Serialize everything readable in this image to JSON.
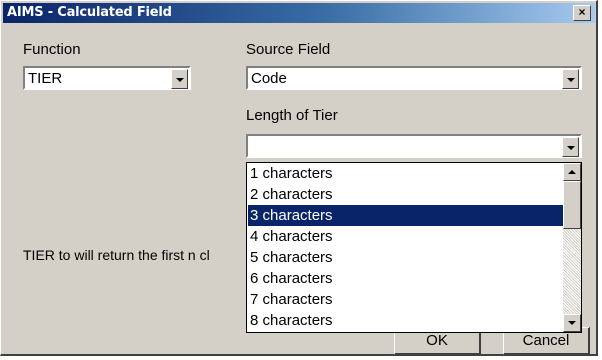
{
  "window": {
    "title": "AIMS - Calculated Field",
    "close_label": "×"
  },
  "function": {
    "label": "Function",
    "value": "TIER"
  },
  "source_field": {
    "label": "Source Field",
    "value": "Code"
  },
  "length_of_tier": {
    "label": "Length of Tier",
    "value": ""
  },
  "description": "TIER to will return the first n cl",
  "dropdown": {
    "options": [
      "1 characters",
      "2 characters",
      "3 characters",
      "4 characters",
      "5 characters",
      "6 characters",
      "7 characters",
      "8 characters"
    ],
    "selected_index": 2
  },
  "buttons": {
    "ok": "OK",
    "cancel": "Cancel"
  },
  "colors": {
    "selection": "#0a246a",
    "title_gradient_start": "#0a246a",
    "dialog_bg": "#d4d0c8"
  }
}
